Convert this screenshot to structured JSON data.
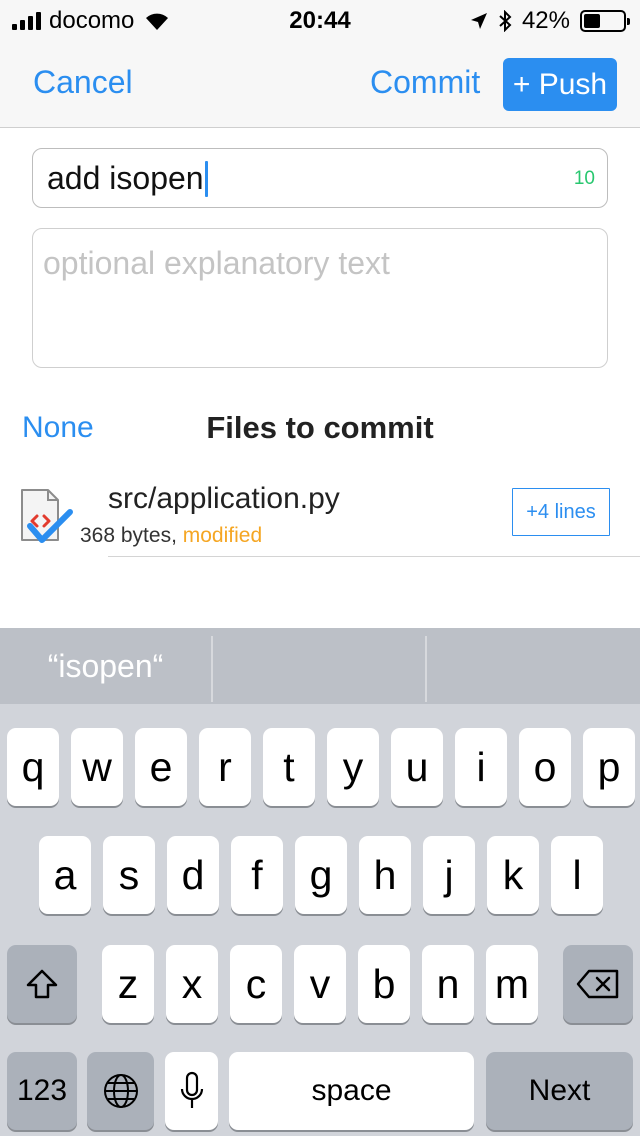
{
  "status_bar": {
    "carrier": "docomo",
    "time": "20:44",
    "battery_percent": "42%",
    "battery_level": 0.42
  },
  "nav": {
    "cancel_label": "Cancel",
    "commit_label": "Commit",
    "push_label": "+ Push"
  },
  "commit_form": {
    "summary_value": "add isopen",
    "summary_count": "10",
    "description_placeholder": "optional explanatory text"
  },
  "files": {
    "none_label": "None",
    "title": "Files to commit",
    "items": [
      {
        "name": "src/application.py",
        "size": "368 bytes,",
        "status": "modified",
        "diff_label": "+4 lines"
      }
    ]
  },
  "keyboard": {
    "suggestions": [
      "“isopen“",
      "",
      ""
    ],
    "row1": [
      "q",
      "w",
      "e",
      "r",
      "t",
      "y",
      "u",
      "i",
      "o",
      "p"
    ],
    "row2": [
      "a",
      "s",
      "d",
      "f",
      "g",
      "h",
      "j",
      "k",
      "l"
    ],
    "row3": [
      "z",
      "x",
      "c",
      "v",
      "b",
      "n",
      "m"
    ],
    "numbers_label": "123",
    "space_label": "space",
    "next_label": "Next"
  },
  "colors": {
    "accent": "#2b8ef0",
    "count": "#28c76f",
    "modified": "#f5a623"
  }
}
